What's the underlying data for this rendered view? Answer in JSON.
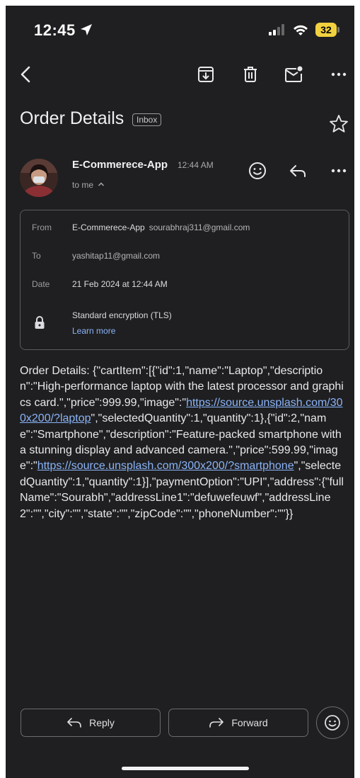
{
  "status_bar": {
    "time": "12:45",
    "battery": "32",
    "battery_color": "#f2d13f"
  },
  "toolbar": {
    "icons": [
      "back-arrow-icon",
      "archive-icon",
      "trash-icon",
      "mark-unread-icon",
      "more-icon"
    ]
  },
  "email": {
    "subject": "Order Details",
    "label": "Inbox",
    "sender_name": "E-Commerece-App",
    "sent_time": "12:44 AM",
    "recipient_summary": "to me"
  },
  "details": {
    "from_label": "From",
    "from_name": "E-Commerece-App",
    "from_email": "sourabhraj311@gmail.com",
    "to_label": "To",
    "to_email": "yashitap11@gmail.com",
    "date_label": "Date",
    "date_value": "21 Feb 2024 at 12:44 AM",
    "encryption": "Standard encryption (TLS)",
    "learn_more": "Learn more"
  },
  "body": {
    "part1": "Order Details: {\"cartItem\":[{\"id\":1,\"name\":\"Laptop\",\"description\":\"High-performance laptop with the latest processor and graphics card.\",\"price\":999.99,\"image\":\"",
    "link1": "https://source.unsplash.com/300x200/?laptop",
    "part2": "\",\"selectedQuantity\":1,\"quantity\":1},{\"id\":2,\"name\":\"Smartphone\",\"description\":\"Feature-packed smartphone with a stunning display and advanced camera.\",\"price\":599.99,\"image\":\"",
    "link2": "https://source.unsplash.com/300x200/?smartphone",
    "part3": "\",\"selectedQuantity\":1,\"quantity\":1}],\"paymentOption\":\"UPI\",\"address\":{\"fullName\":\"Sourabh\",\"addressLine1\":\"defuwefeuwf\",\"addressLine2\":\"\",\"city\":\"\",\"state\":\"\",\"zipCode\":\"\",\"phoneNumber\":\"\"}}"
  },
  "actions": {
    "reply_label": "Reply",
    "forward_label": "Forward"
  },
  "colors": {
    "background": "#1f1f21",
    "link": "#8ab4f8"
  }
}
